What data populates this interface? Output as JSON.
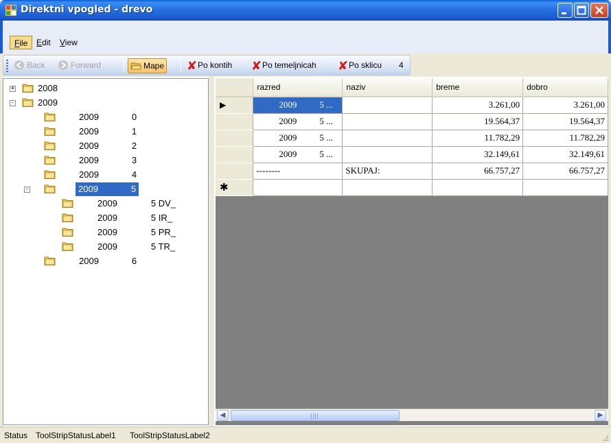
{
  "window": {
    "title": "Direktni vpogled - drevo",
    "controls": {
      "minimize": "minimize",
      "maximize": "maximize",
      "close": "close"
    }
  },
  "menu": {
    "items": [
      {
        "label": "File",
        "accel": "F",
        "rest": "ile"
      },
      {
        "label": "Edit",
        "accel": "E",
        "rest": "dit"
      },
      {
        "label": "View",
        "accel": "V",
        "rest": "iew"
      }
    ]
  },
  "toolbar": {
    "back": "Back",
    "forward": "Forward",
    "mape": "Mape",
    "po_kontih": "Po kontih",
    "po_temeljnicah": "Po temeljnicah",
    "po_sklicu": "Po sklicu",
    "count": "4"
  },
  "tree": {
    "nodes": [
      {
        "label": "2008",
        "code": "",
        "level": 0,
        "expander": "+"
      },
      {
        "label": "2009",
        "code": "",
        "level": 0,
        "expander": "−"
      },
      {
        "label": "2009",
        "code": "0",
        "level": 1,
        "expander": ""
      },
      {
        "label": "2009",
        "code": "1",
        "level": 1,
        "expander": ""
      },
      {
        "label": "2009",
        "code": "2",
        "level": 1,
        "expander": ""
      },
      {
        "label": "2009",
        "code": "3",
        "level": 1,
        "expander": ""
      },
      {
        "label": "2009",
        "code": "4",
        "level": 1,
        "expander": ""
      },
      {
        "label": "2009",
        "code": "5",
        "level": 1,
        "expander": "−",
        "selected": true
      },
      {
        "label": "2009",
        "code": "5 DV_",
        "level": 2,
        "expander": ""
      },
      {
        "label": "2009",
        "code": "5 IR_",
        "level": 2,
        "expander": ""
      },
      {
        "label": "2009",
        "code": "5 PR_",
        "level": 2,
        "expander": ""
      },
      {
        "label": "2009",
        "code": "5 TR_",
        "level": 2,
        "expander": ""
      },
      {
        "label": "2009",
        "code": "6",
        "level": 1,
        "expander": ""
      }
    ]
  },
  "grid": {
    "columns": [
      "razred",
      "naziv",
      "breme",
      "dobro"
    ],
    "rows": [
      {
        "marker": "▶",
        "razred": "2009",
        "razred2": "5 ...",
        "naziv": "",
        "breme": "3.261,00",
        "dobro": "3.261,00",
        "selected": true
      },
      {
        "marker": "",
        "razred": "2009",
        "razred2": "5 ...",
        "naziv": "",
        "breme": "19.564,37",
        "dobro": "19.564,37"
      },
      {
        "marker": "",
        "razred": "2009",
        "razred2": "5 ...",
        "naziv": "",
        "breme": "11.782,29",
        "dobro": "11.782,29"
      },
      {
        "marker": "",
        "razred": "2009",
        "razred2": "5 ...",
        "naziv": "",
        "breme": "32.149,61",
        "dobro": "32.149,61"
      },
      {
        "marker": "",
        "razred": "--------",
        "razred2": "",
        "naziv": "SKUPAJ:",
        "breme": "66.757,27",
        "dobro": "66.757,27"
      }
    ],
    "new_row_marker": "✱"
  },
  "status": {
    "items": [
      "Status",
      "ToolStripStatusLabel1",
      "ToolStripStatusLabel2"
    ]
  }
}
